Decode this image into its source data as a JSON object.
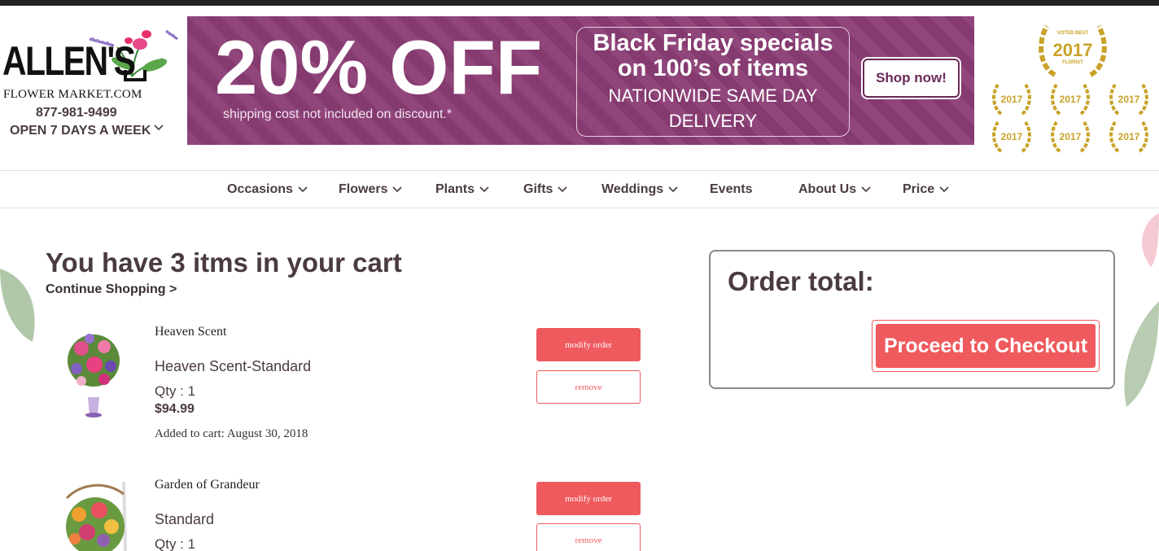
{
  "logo": {
    "wordmark": "ALLEN'S",
    "subtitle": "FLOWER MARKET.COM",
    "phone": "877-981-9499",
    "hours": "OPEN 7 DAYS A WEEK"
  },
  "banner": {
    "headline": "20% OFF",
    "note": "shipping cost not included on discount.*",
    "promo_line1": "Black Friday specials",
    "promo_line2": "on 100’s of items",
    "promo_line3": "NATIONWIDE SAME DAY",
    "promo_line4": "DELIVERY",
    "shop_button": "Shop now!",
    "color": "#8a3c74"
  },
  "awards": {
    "year": "2017",
    "caption_top": "VOTED BEST",
    "caption_bottom": "FLORIST",
    "color": "#c9a227"
  },
  "nav": {
    "items": [
      {
        "label": "Occasions",
        "dropdown": true
      },
      {
        "label": "Flowers",
        "dropdown": true
      },
      {
        "label": "Plants",
        "dropdown": true
      },
      {
        "label": "Gifts",
        "dropdown": true
      },
      {
        "label": "Weddings",
        "dropdown": true
      },
      {
        "label": "Events",
        "dropdown": false
      },
      {
        "label": "About Us",
        "dropdown": true
      },
      {
        "label": "Price",
        "dropdown": true
      }
    ]
  },
  "cart": {
    "title": "You have 3 itms in your cart",
    "continue_link": "Continue Shopping >",
    "items": [
      {
        "name": "Heaven Scent",
        "variant": "Heaven Scent-Standard",
        "qty": "Qty : 1",
        "price": "$94.99",
        "added": "Added to cart: August 30, 2018",
        "modify_label": "modify order",
        "remove_label": "remove"
      },
      {
        "name": "Garden of Grandeur",
        "variant": "Standard",
        "qty": "Qty : 1",
        "modify_label": "modify order",
        "remove_label": "remove"
      }
    ]
  },
  "order": {
    "title": "Order total:",
    "checkout_label": "Proceed to Checkout",
    "accent": "#ef5a5e"
  }
}
